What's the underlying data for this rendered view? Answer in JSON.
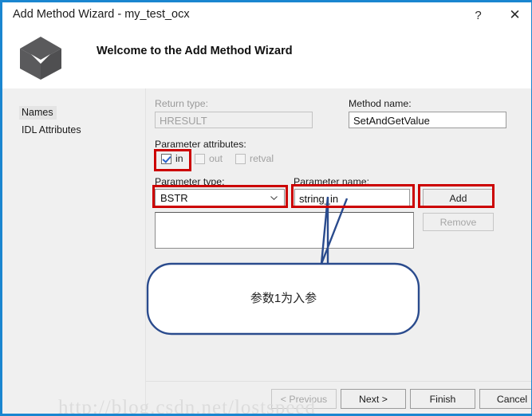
{
  "window": {
    "title": "Add Method Wizard - my_test_ocx",
    "help_label": "?",
    "close_label": "✕",
    "accent_color": "#1a86d0"
  },
  "header": {
    "title": "Welcome to the Add Method Wizard",
    "icon": "cube-icon"
  },
  "sidebar": {
    "items": [
      {
        "label": "Names",
        "selected": true
      },
      {
        "label": "IDL Attributes",
        "selected": false
      }
    ]
  },
  "form": {
    "return_type": {
      "label": "Return type:",
      "value": "HRESULT",
      "disabled": true
    },
    "method_name": {
      "label": "Method name:",
      "value": "SetAndGetValue",
      "disabled": false
    },
    "parameter_attributes": {
      "label": "Parameter attributes:",
      "checkboxes": [
        {
          "label": "in",
          "checked": true,
          "disabled": false
        },
        {
          "label": "out",
          "checked": false,
          "disabled": true
        },
        {
          "label": "retval",
          "checked": false,
          "disabled": true
        }
      ]
    },
    "parameter_type": {
      "label": "Parameter type:",
      "value": "BSTR"
    },
    "parameter_name": {
      "label": "Parameter name:",
      "value": "string_in"
    },
    "add_button": {
      "label": "Add",
      "disabled": false
    },
    "remove_button": {
      "label": "Remove",
      "disabled": true
    },
    "parameter_list": {
      "items": []
    }
  },
  "footer": {
    "buttons": [
      {
        "label": "< Previous",
        "disabled": true
      },
      {
        "label": "Next >",
        "disabled": false
      },
      {
        "label": "Finish",
        "disabled": false
      },
      {
        "label": "Cancel",
        "disabled": false
      }
    ]
  },
  "annotations": {
    "callout_text": "参数1为入参",
    "box_color": "#cc0000",
    "callout_color": "#2a4b8d",
    "highlight_targets": [
      "in-checkbox",
      "parameter-type-combo",
      "parameter-name-field",
      "add-button"
    ]
  },
  "watermark": {
    "text": "http://blog.csdn.net/lostspeed"
  }
}
